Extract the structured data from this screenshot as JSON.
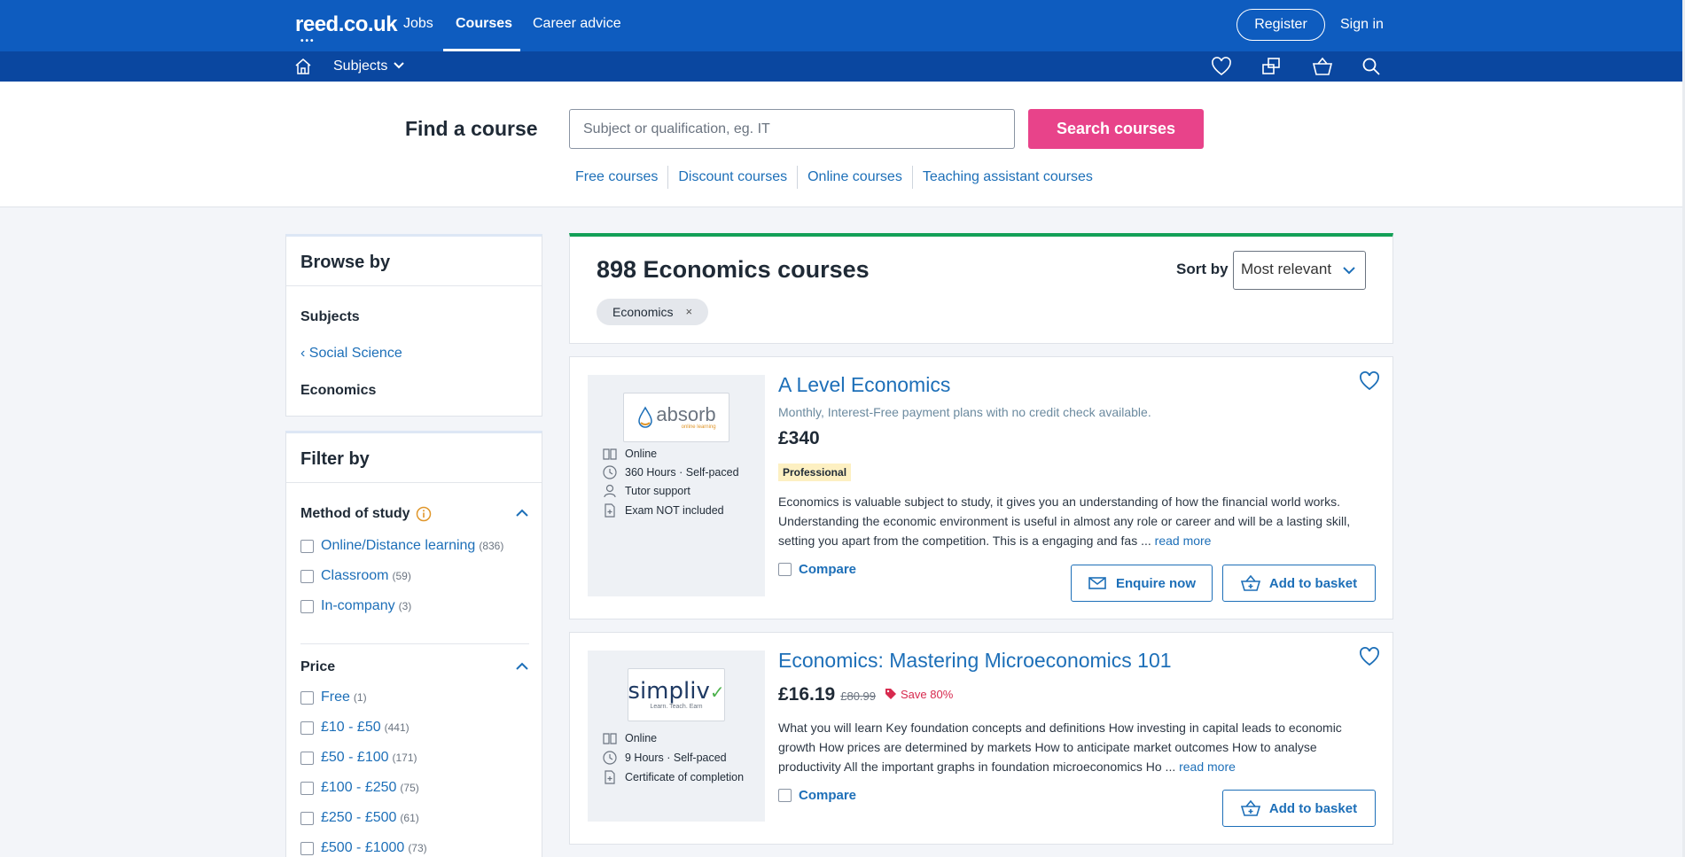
{
  "header": {
    "logo": "reed.co.uk",
    "nav": [
      {
        "label": "Jobs"
      },
      {
        "label": "Courses"
      },
      {
        "label": "Career advice"
      }
    ],
    "register_label": "Register",
    "signin_label": "Sign in"
  },
  "subnav": {
    "subjects_label": "Subjects",
    "icons": [
      "home-icon",
      "heart-icon",
      "compare-icon",
      "basket-icon",
      "search-icon"
    ]
  },
  "search": {
    "title": "Find a course",
    "placeholder": "Subject or qualification, eg. IT",
    "button_label": "Search courses",
    "quick_links": [
      "Free courses",
      "Discount courses",
      "Online courses",
      "Teaching assistant courses"
    ]
  },
  "browse": {
    "title": "Browse by",
    "subjects_label": "Subjects",
    "parent_link": "Social Science",
    "current": "Economics"
  },
  "filter": {
    "title": "Filter by",
    "method": {
      "title": "Method of study",
      "options": [
        {
          "label": "Online/Distance learning",
          "count": "(836)"
        },
        {
          "label": "Classroom",
          "count": "(59)"
        },
        {
          "label": "In-company",
          "count": "(3)"
        }
      ]
    },
    "price": {
      "title": "Price",
      "options": [
        {
          "label": "Free",
          "count": "(1)"
        },
        {
          "label": "£10 - £50",
          "count": "(441)"
        },
        {
          "label": "£50 - £100",
          "count": "(171)"
        },
        {
          "label": "£100 - £250",
          "count": "(75)"
        },
        {
          "label": "£250 - £500",
          "count": "(61)"
        },
        {
          "label": "£500 - £1000",
          "count": "(73)"
        }
      ]
    }
  },
  "results": {
    "title": "898 Economics courses",
    "sort_label": "Sort by",
    "sort_value": "Most relevant",
    "active_tag": "Economics",
    "tag_remove": "×"
  },
  "courses": [
    {
      "provider": "absorb",
      "provider_tagline": "online learning",
      "title": "A Level Economics",
      "subline": "Monthly, Interest-Free payment plans with no credit check available.",
      "price": "£340",
      "badge": "Professional",
      "meta": [
        "Online",
        "360 Hours · Self-paced",
        "Tutor support",
        "Exam NOT included"
      ],
      "description": "Economics is valuable subject to study, it gives you an understanding of how the financial world works. Understanding the economic environment is useful in almost any role or career and will be a lasting skill, setting you apart from the competition. This is a engaging and fas ...",
      "read_more": "read more",
      "compare_label": "Compare",
      "enquire_label": "Enquire now",
      "basket_label": "Add to basket"
    },
    {
      "provider": "simpliv",
      "provider_tagline": "Learn. Teach. Earn",
      "title": "Economics: Mastering Microeconomics 101",
      "price": "£16.19",
      "old_price": "£80.99",
      "save": "Save 80%",
      "meta": [
        "Online",
        "9 Hours · Self-paced",
        "Certificate of completion"
      ],
      "description": "What you will learn Key foundation concepts and definitions How investing in capital leads to economic growth How prices are determined by markets How to anticipate market outcomes How to analyse productivity All the important graphs in foundation microeconomics Ho ...",
      "read_more": "read more",
      "compare_label": "Compare",
      "basket_label": "Add to basket"
    }
  ],
  "colors": {
    "header_blue": "#0e5cbf",
    "subnav_blue": "#0a47a0",
    "accent_pink": "#e8438a",
    "link_blue": "#1d6fb8",
    "header_bar_green": "#13a057"
  }
}
